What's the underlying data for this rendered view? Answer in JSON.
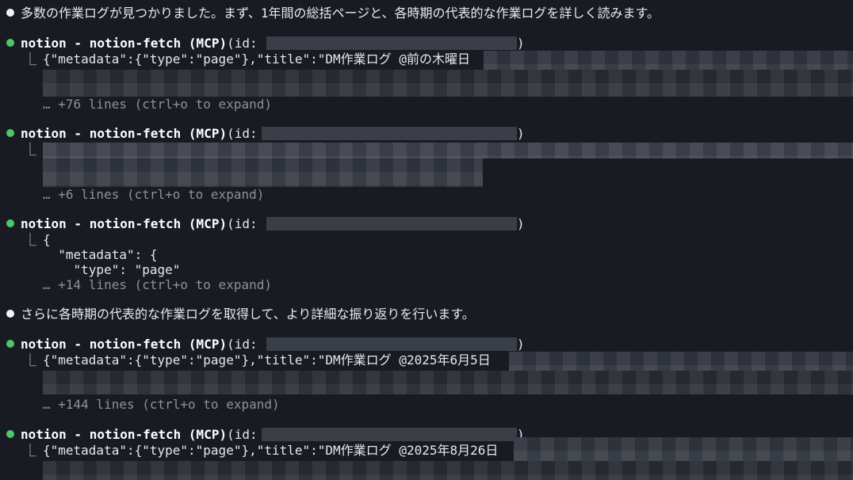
{
  "messages": [
    {
      "text": "多数の作業ログが見つかりました。まず、1年間の総括ページと、各時期の代表的な作業ログを詳しく読みます。"
    },
    {
      "text": "さらに各時期の代表的な作業ログを取得して、より詳細な振り返りを行います。"
    }
  ],
  "tool_calls": [
    {
      "name": "notion - notion-fetch (MCP)",
      "args_prefix": "(id: ",
      "args_suffix": ")",
      "result_line": "{\"metadata\":{\"type\":\"page\"},\"title\":\"DM作業ログ @前の木曜日",
      "more": "… +76 lines (ctrl+o to expand)"
    },
    {
      "name": "notion - notion-fetch (MCP)",
      "args_prefix": "(id: ",
      "args_suffix": ")",
      "result_line": "",
      "more": "… +6 lines (ctrl+o to expand)"
    },
    {
      "name": "notion - notion-fetch (MCP)",
      "args_prefix": "(id: ",
      "args_suffix": ")",
      "result_line": "{",
      "result_line2": "  \"metadata\": {",
      "result_line3": "    \"type\": \"page\"",
      "more": "… +14 lines (ctrl+o to expand)"
    },
    {
      "name": "notion - notion-fetch (MCP)",
      "args_prefix": "(id: ",
      "args_suffix": ")",
      "result_line": "{\"metadata\":{\"type\":\"page\"},\"title\":\"DM作業ログ @2025年6月5日",
      "more": "… +144 lines (ctrl+o to expand)"
    },
    {
      "name": "notion - notion-fetch (MCP)",
      "args_prefix": "(id: ",
      "args_suffix": ")",
      "result_line": "{\"metadata\":{\"type\":\"page\"},\"title\":\"DM作業ログ @2025年8月26日"
    }
  ],
  "colors": {
    "background": "#181b22",
    "bullet_tool": "#4fc56c",
    "bullet_message": "#f2f2f2",
    "muted": "#8d929b"
  },
  "icons": {
    "tool_bullet": "green-dot-icon",
    "message_bullet": "white-dot-icon",
    "result_corner": "tree-corner-icon"
  }
}
